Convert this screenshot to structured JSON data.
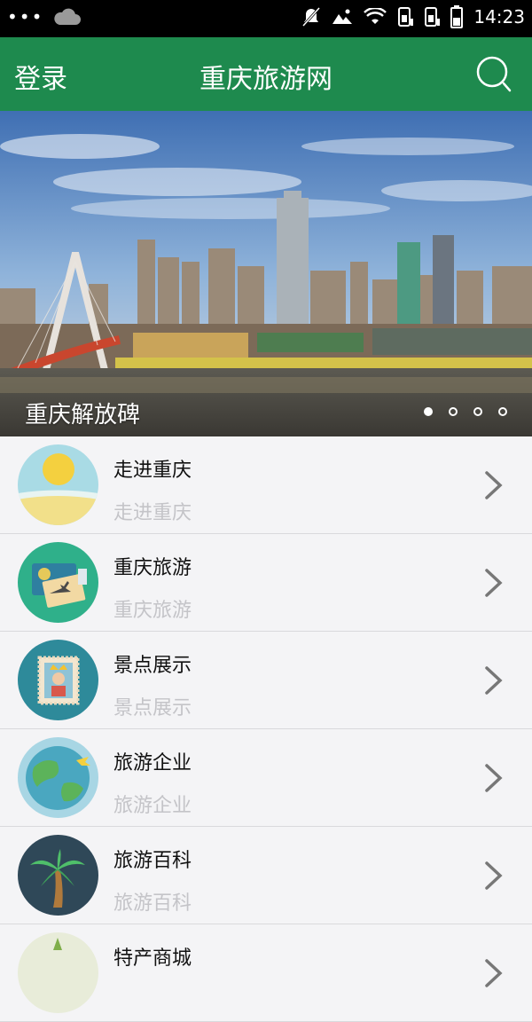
{
  "status_bar": {
    "overflow": "•••",
    "time": "14:23",
    "icons": [
      "cloud-icon",
      "mute-icon",
      "image-icon",
      "wifi-icon",
      "sim1-icon",
      "sim2-icon",
      "battery-icon"
    ]
  },
  "header": {
    "login_label": "登录",
    "title": "重庆旅游网",
    "search_icon": "search-icon",
    "background": "#1e8a4e"
  },
  "banner": {
    "caption": "重庆解放碑",
    "page_count": 4,
    "active_index": 0
  },
  "list": {
    "items": [
      {
        "title": "走进重庆",
        "subtitle": "走进重庆",
        "icon": "sun-beach-icon"
      },
      {
        "title": "重庆旅游",
        "subtitle": "重庆旅游",
        "icon": "passport-ticket-icon"
      },
      {
        "title": "景点展示",
        "subtitle": "景点展示",
        "icon": "stamp-king-icon"
      },
      {
        "title": "旅游企业",
        "subtitle": "旅游企业",
        "icon": "globe-plane-icon"
      },
      {
        "title": "旅游百科",
        "subtitle": "旅游百科",
        "icon": "palm-tree-icon"
      },
      {
        "title": "特产商城",
        "subtitle": "",
        "icon": "mall-icon"
      }
    ]
  }
}
